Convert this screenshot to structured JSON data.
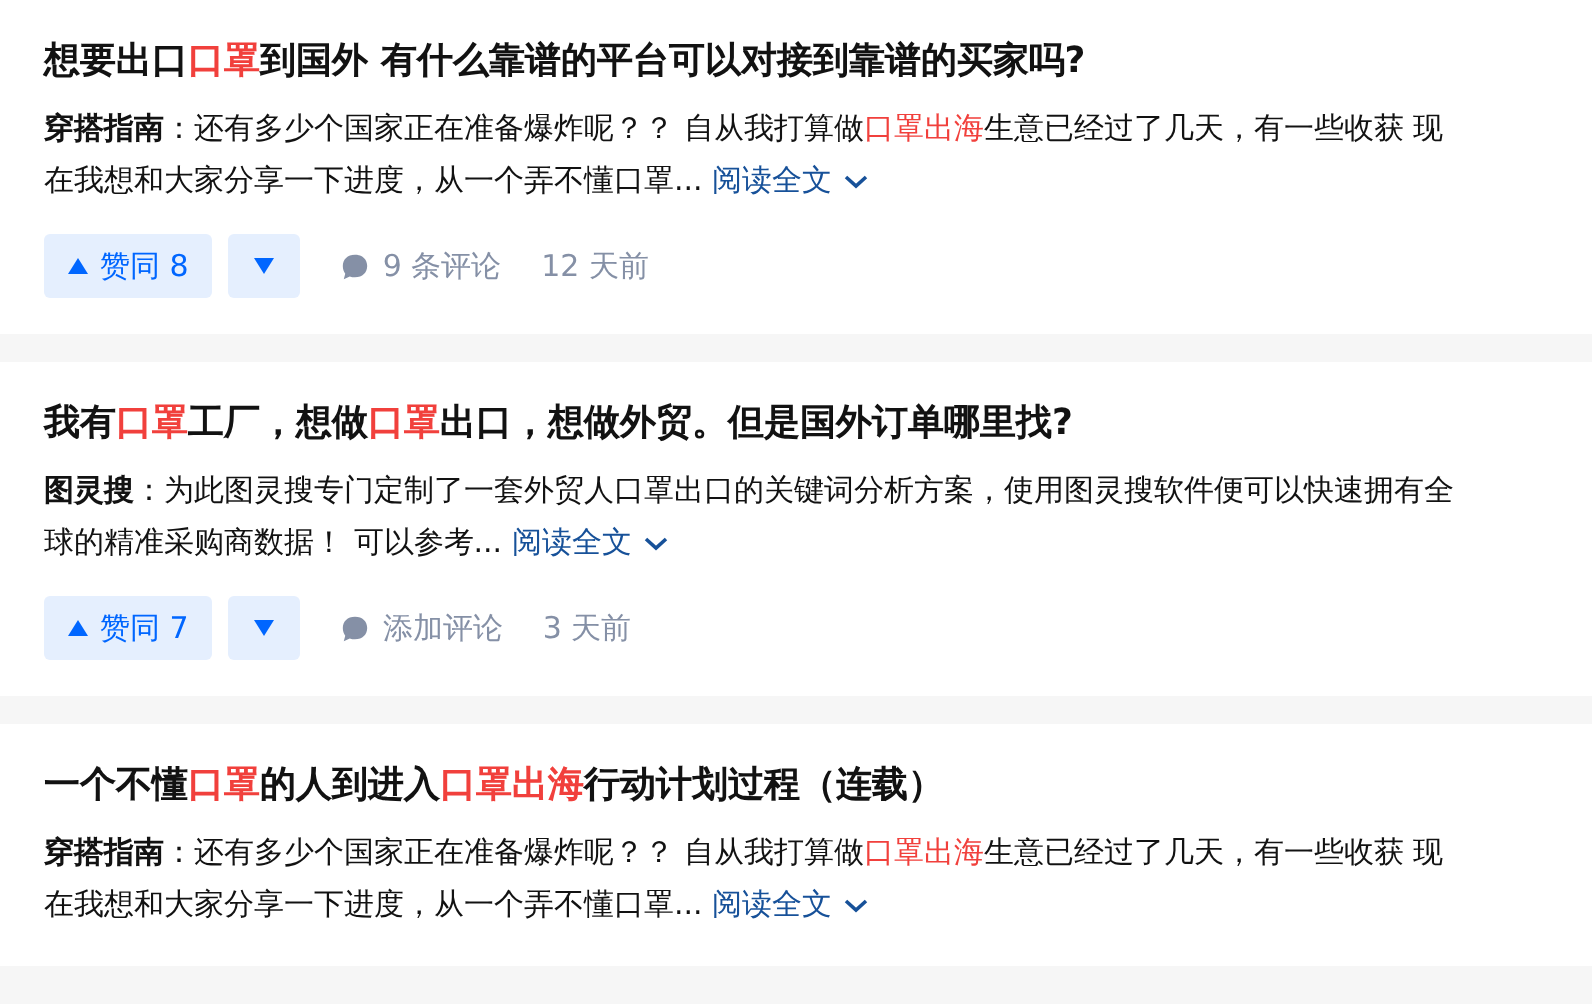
{
  "answers": [
    {
      "title": [
        {
          "text": "想要出口",
          "highlight": false
        },
        {
          "text": "口罩",
          "highlight": true
        },
        {
          "text": "到国外 有什么靠谱的平台可以对接到靠谱的买家吗?",
          "highlight": false
        }
      ],
      "author": "穿搭指南",
      "excerpt": [
        {
          "text": "：还有多少个国家正在准备爆炸呢？？  自从我打算做",
          "highlight": false
        },
        {
          "text": "口罩出海",
          "highlight": true
        },
        {
          "text": "生意已经过了几天，有一些收获 现在我想和大家分享一下进度，从一个弄不懂口罩...",
          "highlight": false
        }
      ],
      "read_more": "阅读全文",
      "actions": {
        "upvote": "赞同 8",
        "comments": "9 条评论",
        "time": "12 天前"
      }
    },
    {
      "title": [
        {
          "text": "我有",
          "highlight": false
        },
        {
          "text": "口罩",
          "highlight": true
        },
        {
          "text": "工厂，想做",
          "highlight": false
        },
        {
          "text": "口罩",
          "highlight": true
        },
        {
          "text": "出口，想做外贸。但是国外订单哪里找?",
          "highlight": false
        }
      ],
      "author": "图灵搜",
      "excerpt": [
        {
          "text": "：为此图灵搜专门定制了一套外贸人口罩出口的关键词分析方案，使用图灵搜软件便可以快速拥有全球的精准采购商数据！ 可以参考...",
          "highlight": false
        }
      ],
      "read_more": "阅读全文",
      "actions": {
        "upvote": "赞同 7",
        "comments": "添加评论",
        "time": "3 天前"
      }
    },
    {
      "title": [
        {
          "text": "一个不懂",
          "highlight": false
        },
        {
          "text": "口罩",
          "highlight": true
        },
        {
          "text": "的人到进入",
          "highlight": false
        },
        {
          "text": "口罩出海",
          "highlight": true
        },
        {
          "text": "行动计划过程（连载）",
          "highlight": false
        }
      ],
      "author": "穿搭指南",
      "excerpt": [
        {
          "text": "：还有多少个国家正在准备爆炸呢？？  自从我打算做",
          "highlight": false
        },
        {
          "text": "口罩出海",
          "highlight": true
        },
        {
          "text": "生意已经过了几天，有一些收获 现在我想和大家分享一下进度，从一个弄不懂口罩...",
          "highlight": false
        }
      ],
      "read_more": "阅读全文"
    }
  ]
}
